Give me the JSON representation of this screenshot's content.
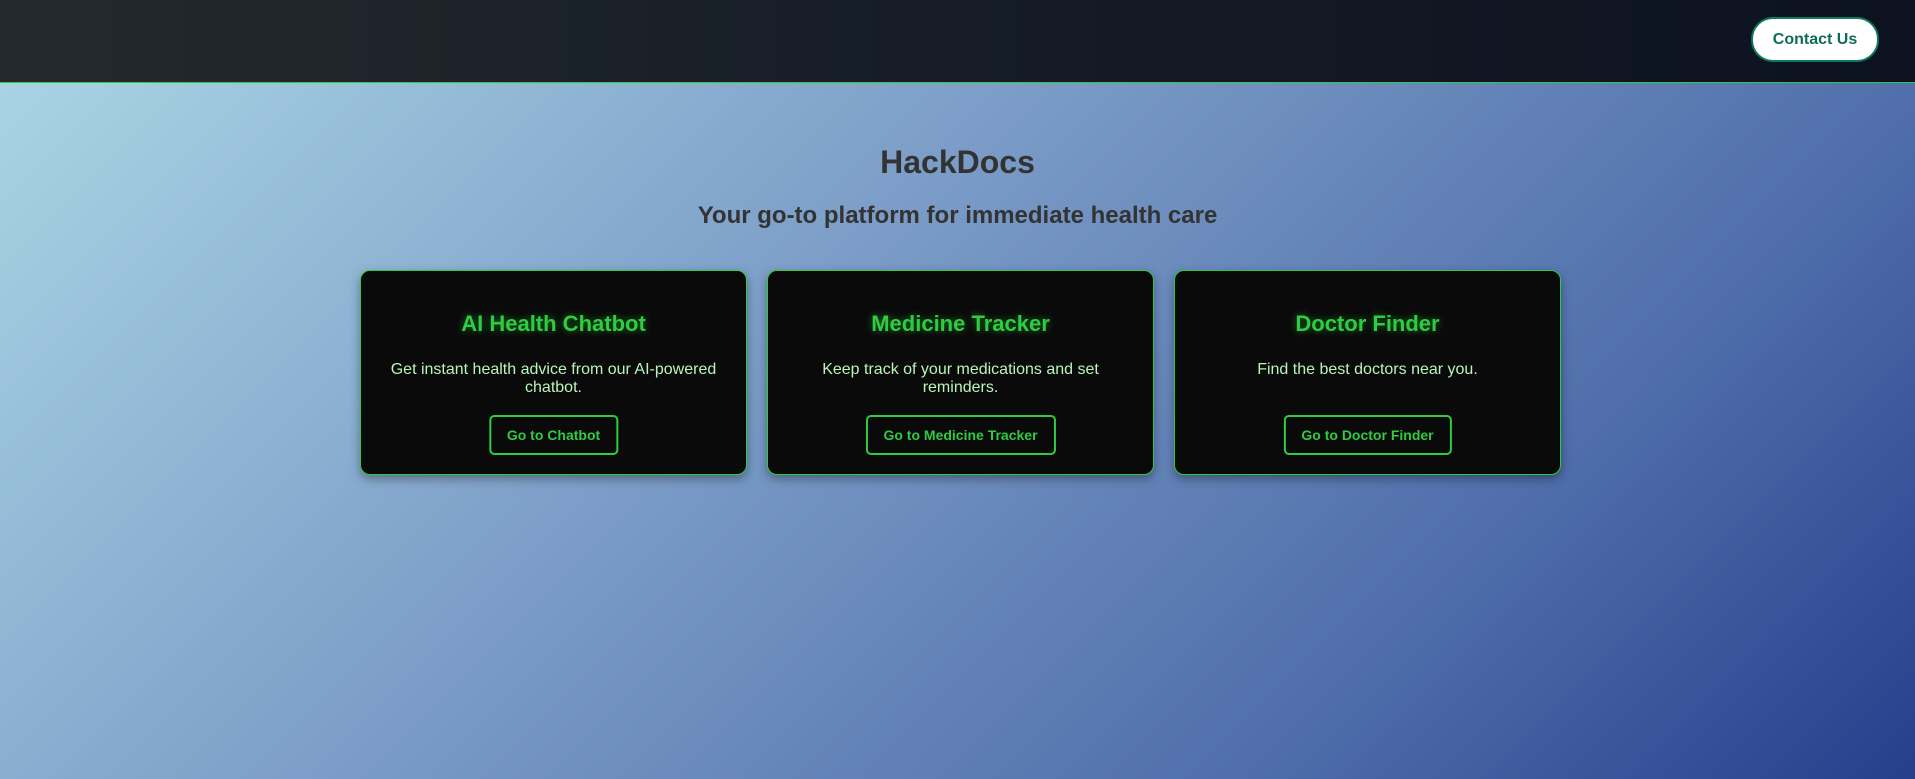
{
  "header": {
    "contact_label": "Contact Us"
  },
  "hero": {
    "title": "HackDocs",
    "subtitle": "Your go-to platform for immediate health care"
  },
  "cards": [
    {
      "title": "AI Health Chatbot",
      "description": "Get instant health advice from our AI-powered chatbot.",
      "button": "Go to Chatbot"
    },
    {
      "title": "Medicine Tracker",
      "description": "Keep track of your medications and set reminders.",
      "button": "Go to Medicine Tracker"
    },
    {
      "title": "Doctor Finder",
      "description": "Find the best doctors near you.",
      "button": "Go to Doctor Finder"
    }
  ],
  "colors": {
    "accent": "#2ecc40",
    "card_bg": "#0a0a0a",
    "header_bg": "#151c26",
    "contact_text": "#0e6e55"
  }
}
